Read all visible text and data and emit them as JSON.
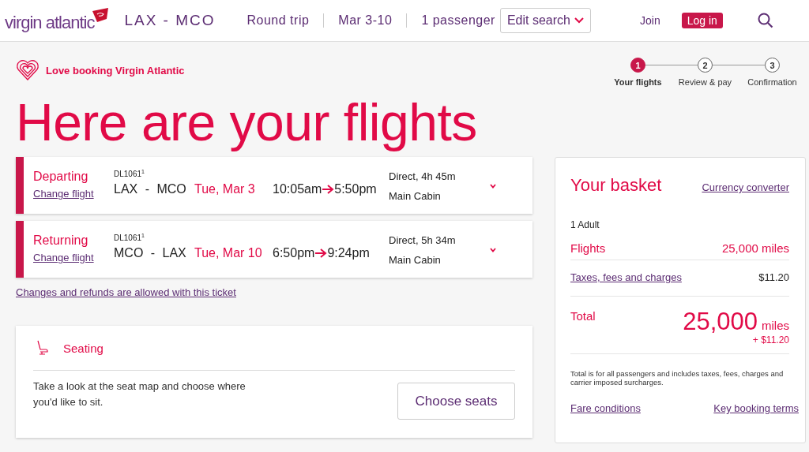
{
  "header": {
    "logo": "virgin atlantic",
    "route": "LAX - MCO",
    "trip": "Round trip",
    "dates": "Mar 3-10",
    "passengers": "1 passenger",
    "edit_search": "Edit search",
    "join": "Join",
    "login": "Log in"
  },
  "tagline": "Love booking Virgin Atlantic",
  "steps": [
    {
      "number": "1",
      "label": "Your flights",
      "selected": true
    },
    {
      "number": "2",
      "label": "Review & pay",
      "selected": false
    },
    {
      "number": "3",
      "label": "Confirmation",
      "selected": false
    }
  ],
  "title": "Here are your flights",
  "flights": [
    {
      "direction": "Departing",
      "change": "Change flight",
      "flight_no": "DL1061$^{1}$",
      "route": "LAX - MCO",
      "date": "Tue, Mar 3",
      "depart": "10:05am",
      "arrive": "5:50pm",
      "stops": "Direct, 4h 45m",
      "cabin": "Main Cabin"
    },
    {
      "direction": "Returning",
      "change": "Change flight",
      "flight_no": "DL1061$^{1}$",
      "route": "MCO - LAX",
      "date": "Tue, Mar 10",
      "depart": "6:50pm",
      "arrive": "9:24pm",
      "stops": "Direct, 5h 34m",
      "cabin": "Main Cabin"
    }
  ],
  "changes_link": "Changes and refunds are allowed with this ticket",
  "seating": {
    "title": "Seating",
    "text": "Take a look at the seat map and choose where you'd like to sit.",
    "button": "Choose seats"
  },
  "basket": {
    "title": "Your basket",
    "currency_link": "Currency converter",
    "passengers": "1 Adult",
    "flights_label": "Flights",
    "flights_value": "25,000 miles",
    "taxes_label": "Taxes, fees and charges",
    "taxes_value": "$11.20",
    "total_label": "Total",
    "total_miles": "25,000",
    "total_unit": "miles",
    "total_cash": "+ $11.20",
    "note": "Total is for all passengers and includes taxes, fees, charges and carrier imposed surcharges.",
    "fare_link": "Fare conditions",
    "terms_link": "Key booking terms"
  }
}
